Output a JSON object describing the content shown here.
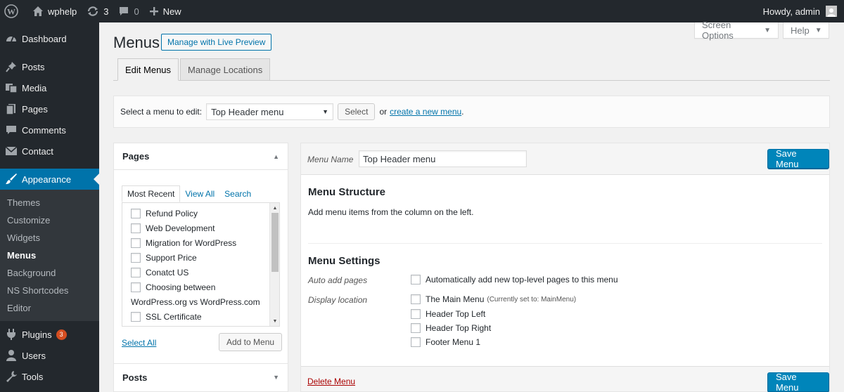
{
  "adminbar": {
    "wp_logo_icon": "wordpress-logo-icon",
    "site_name": "wphelp",
    "updates_count": "3",
    "comments_count": "0",
    "new_label": "New",
    "howdy": "Howdy, admin"
  },
  "sidebar": {
    "items": [
      {
        "label": "Dashboard",
        "icon": "dashboard-icon"
      },
      {
        "label": "Posts",
        "icon": "pin-icon"
      },
      {
        "label": "Media",
        "icon": "media-icon"
      },
      {
        "label": "Pages",
        "icon": "pages-icon"
      },
      {
        "label": "Comments",
        "icon": "comment-icon"
      },
      {
        "label": "Contact",
        "icon": "mail-icon"
      },
      {
        "label": "Appearance",
        "icon": "brush-icon"
      }
    ],
    "submenu": [
      "Themes",
      "Customize",
      "Widgets",
      "Menus",
      "Background",
      "NS Shortcodes",
      "Editor"
    ],
    "after_items": [
      {
        "label": "Plugins",
        "icon": "plug-icon",
        "badge": "3"
      },
      {
        "label": "Users",
        "icon": "user-icon"
      },
      {
        "label": "Tools",
        "icon": "wrench-icon"
      }
    ]
  },
  "header": {
    "title": "Menus",
    "live_preview": "Manage with Live Preview",
    "screen_options": "Screen Options",
    "help": "Help"
  },
  "tabs": [
    "Edit Menus",
    "Manage Locations"
  ],
  "manage": {
    "label": "Select a menu to edit:",
    "selected": "Top Header menu",
    "select_btn": "Select",
    "or_text": "or",
    "create_link": "create a new menu",
    "period": "."
  },
  "pages_box": {
    "title": "Pages",
    "inner_tabs": [
      "Most Recent",
      "View All",
      "Search"
    ],
    "items": [
      "Refund Policy",
      "Web Development",
      "Migration for WordPress",
      "Support Price",
      "Conatct US",
      "Choosing between",
      "WordPress.org vs WordPress.com",
      "SSL Certificate"
    ],
    "select_all": "Select All",
    "add_to_menu": "Add to Menu"
  },
  "posts_box": {
    "title": "Posts"
  },
  "menu_edit": {
    "name_label": "Menu Name",
    "name_value": "Top Header menu",
    "save": "Save Menu",
    "structure_title": "Menu Structure",
    "structure_desc": "Add menu items from the column on the left.",
    "settings_title": "Menu Settings",
    "auto_add_label": "Auto add pages",
    "auto_add_option": "Automatically add new top-level pages to this menu",
    "display_location_label": "Display location",
    "locations": [
      "The Main Menu",
      "Header Top Left",
      "Header Top Right",
      "Footer Menu 1"
    ],
    "main_menu_note": "(Currently set to: MainMenu)",
    "delete": "Delete Menu"
  },
  "colors": {
    "accent": "#0073aa",
    "primary_button": "#0085ba",
    "sidebar_bg": "#23282d",
    "badge": "#d54e21",
    "delete": "#aa0000"
  }
}
